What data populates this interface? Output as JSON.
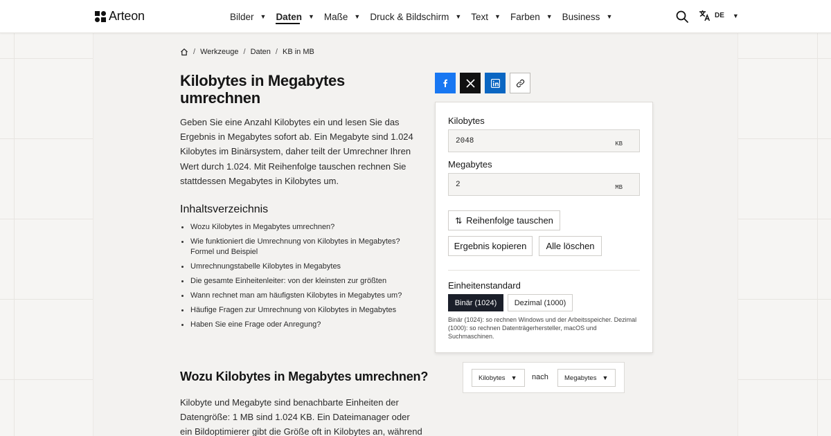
{
  "header": {
    "logo_text": "Arteon",
    "nav": [
      {
        "label": "Bilder",
        "active": false
      },
      {
        "label": "Daten",
        "active": true
      },
      {
        "label": "Maße",
        "active": false
      },
      {
        "label": "Druck & Bildschirm",
        "active": false
      },
      {
        "label": "Text",
        "active": false
      },
      {
        "label": "Farben",
        "active": false
      },
      {
        "label": "Business",
        "active": false
      }
    ],
    "language": "DE"
  },
  "breadcrumb": [
    "Werkzeuge",
    "Daten",
    "KB in MB"
  ],
  "page": {
    "title": "Kilobytes in Megabytes umrechnen",
    "intro": "Geben Sie eine Anzahl Kilobytes ein und lesen Sie das Ergebnis in Megabytes sofort ab. Ein Megabyte sind 1.024 Kilobytes im Binärsystem, daher teilt der Umrechner Ihren Wert durch 1.024. Mit Reihenfolge tauschen rechnen Sie stattdessen Megabytes in Kilobytes um.",
    "toc_title": "Inhaltsverzeichnis",
    "toc": [
      "Wozu Kilobytes in Megabytes umrechnen?",
      "Wie funktioniert die Umrechnung von Kilobytes in Megabytes? Formel und Beispiel",
      "Umrechnungstabelle Kilobytes in Megabytes",
      "Die gesamte Einheitenleiter: von der kleinsten zur größten",
      "Wann rechnet man am häufigsten Kilobytes in Megabytes um?",
      "Häufige Fragen zur Umrechnung von Kilobytes in Megabytes",
      "Haben Sie eine Frage oder Anregung?"
    ],
    "section_title": "Wozu Kilobytes in Megabytes umrechnen?",
    "section_text": "Kilobyte und Megabyte sind benachbarte Einheiten der Datengröße: 1 MB sind 1.024 KB. Ein Dateimanager oder ein Bildoptimierer gibt die Größe oft in Kilobytes an, während"
  },
  "converter": {
    "input_label": "Kilobytes",
    "input_value": "2048",
    "input_unit": "KB",
    "output_label": "Megabytes",
    "output_value": "2",
    "output_unit": "MB",
    "swap_label": "Reihenfolge tauschen",
    "copy_label": "Ergebnis kopieren",
    "clear_label": "Alle löschen",
    "standard_label": "Einheitenstandard",
    "binary_label": "Binär (1024)",
    "decimal_label": "Dezimal (1000)",
    "standard_note": "Binär (1024): so rechnen Windows und der Arbeitsspeicher. Dezimal (1000): so rechnen Datenträgerhersteller, macOS und Suchmaschinen."
  },
  "unit_selector": {
    "from": "Kilobytes",
    "connector": "nach",
    "to": "Megabytes"
  },
  "colors": {
    "facebook": "#1877f2",
    "x": "#111111",
    "linkedin": "#0a66c2",
    "active_standard": "#1b1f2a"
  }
}
